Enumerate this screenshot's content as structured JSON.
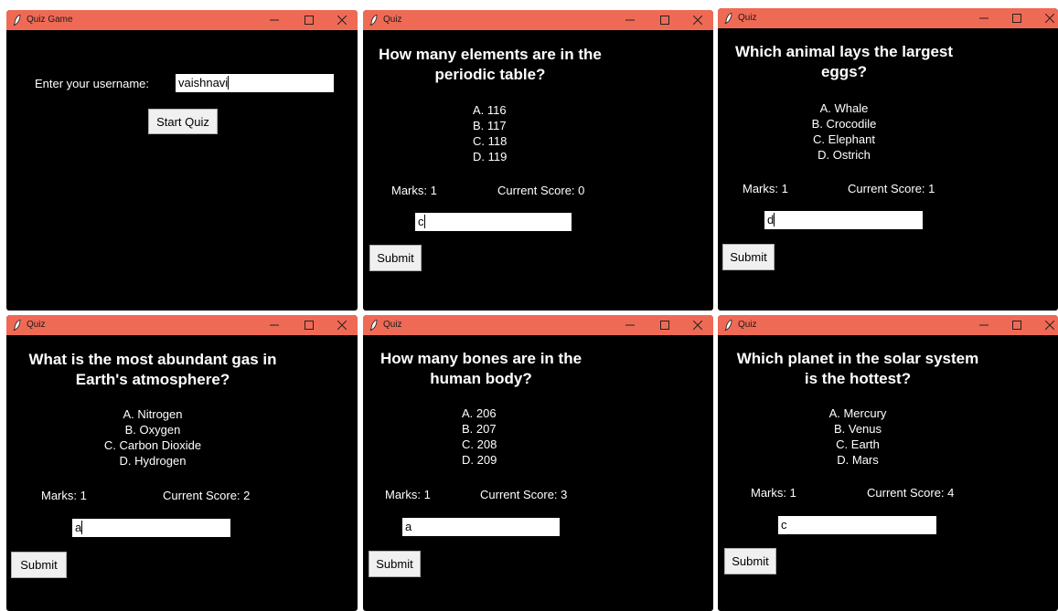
{
  "login_window": {
    "title": "Quiz Game",
    "username_label": "Enter your username:",
    "username_value": "vaishnavi",
    "start_button": "Start Quiz"
  },
  "quiz_windows": [
    {
      "title": "Quiz",
      "question_line1": "How many elements are in the",
      "question_line2": "periodic table?",
      "options": [
        "A. 116",
        "B. 117",
        "C. 118",
        "D. 119"
      ],
      "marks": "Marks: 1",
      "score": "Current Score: 0",
      "answer": "c",
      "submit": "Submit"
    },
    {
      "title": "Quiz",
      "question_line1": "Which animal lays the largest",
      "question_line2": "eggs?",
      "options": [
        "A. Whale",
        "B. Crocodile",
        "C. Elephant",
        "D. Ostrich"
      ],
      "marks": "Marks: 1",
      "score": "Current Score: 1",
      "answer": "d",
      "submit": "Submit"
    },
    {
      "title": "Quiz",
      "question_line1": "What is the most abundant gas in",
      "question_line2": "Earth's atmosphere?",
      "options": [
        "A. Nitrogen",
        "B. Oxygen",
        "C. Carbon Dioxide",
        "D. Hydrogen"
      ],
      "marks": "Marks: 1",
      "score": "Current Score: 2",
      "answer": "a",
      "submit": "Submit"
    },
    {
      "title": "Quiz",
      "question_line1": "How many bones are in the",
      "question_line2": "human body?",
      "options": [
        "A. 206",
        "B. 207",
        "C. 208",
        "D. 209"
      ],
      "marks": "Marks: 1",
      "score": "Current Score: 3",
      "answer": "a",
      "submit": "Submit"
    },
    {
      "title": "Quiz",
      "question_line1": "Which planet in the solar system",
      "question_line2": "is the hottest?",
      "options": [
        "A. Mercury",
        "B. Venus",
        "C. Earth",
        "D. Mars"
      ],
      "marks": "Marks: 1",
      "score": "Current Score: 4",
      "answer": "c",
      "submit": "Submit"
    }
  ],
  "icons": {
    "app": "feather-icon",
    "minimize": "minimize-icon",
    "maximize": "maximize-icon",
    "close": "close-icon"
  },
  "colors": {
    "titlebar": "#ef6a55",
    "window_bg": "#000000",
    "text": "#ffffff"
  }
}
